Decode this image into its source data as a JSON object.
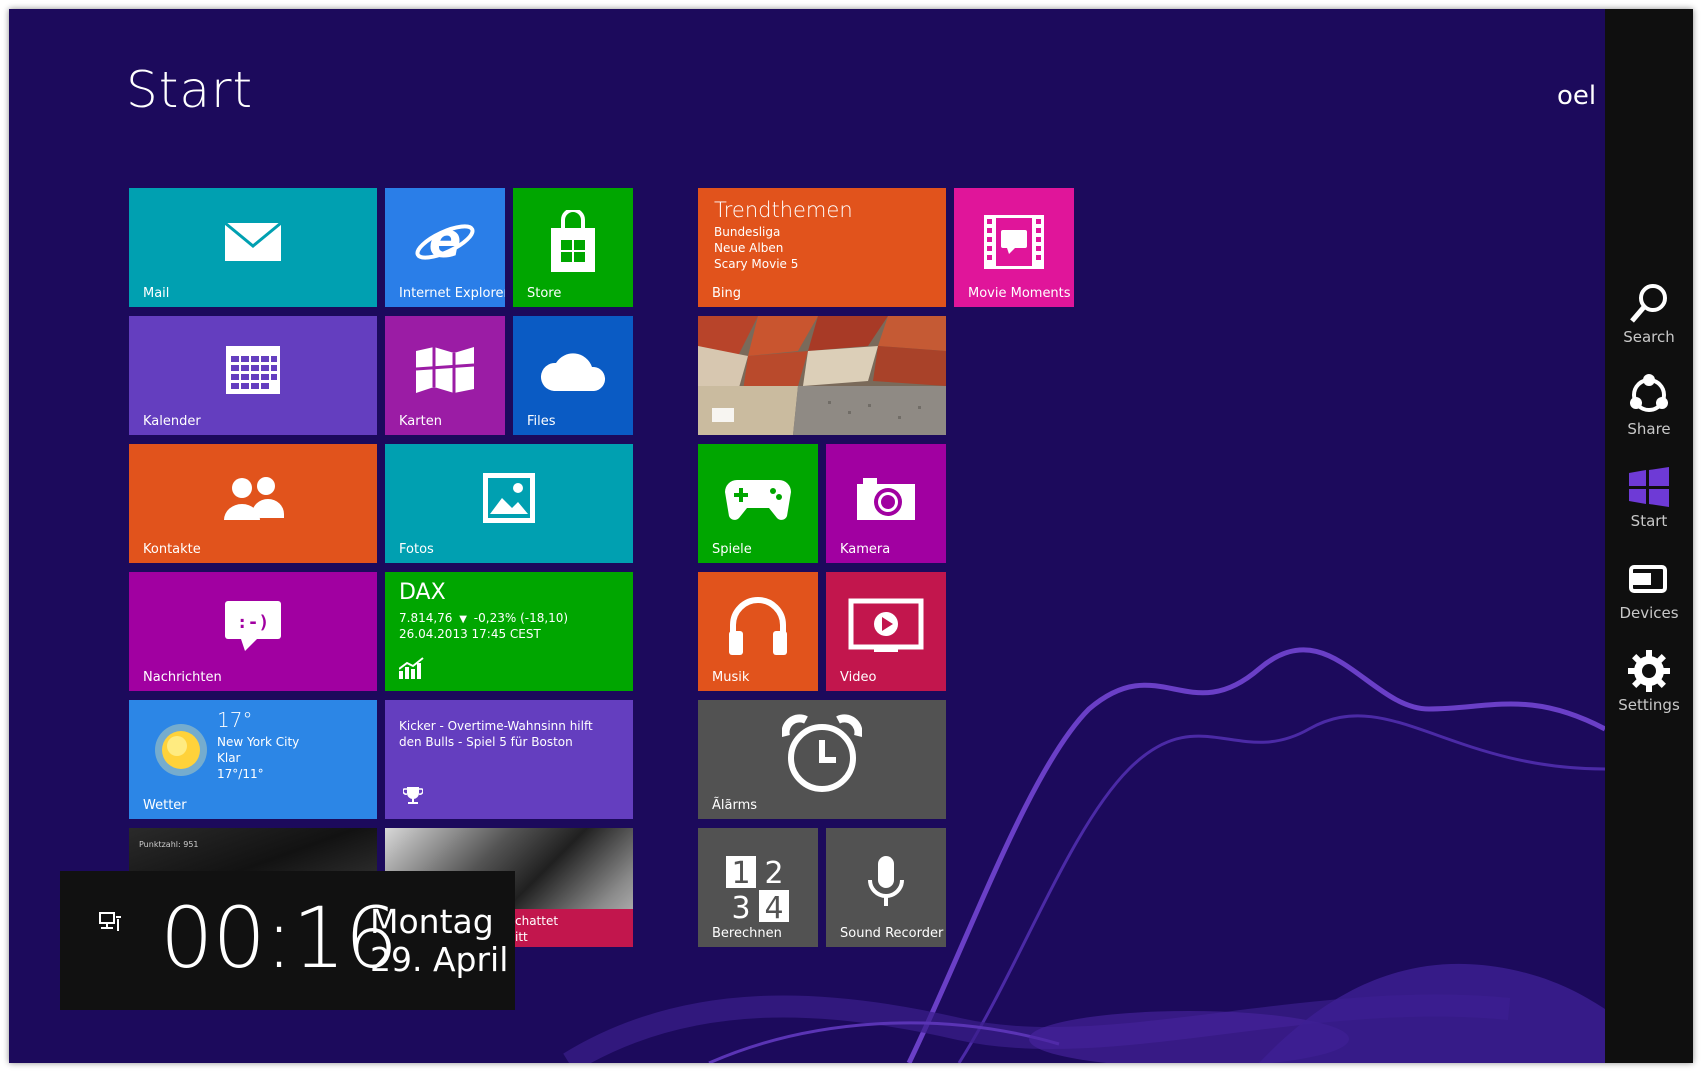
{
  "screen": {
    "title": "Start",
    "user": "oel"
  },
  "tiles": {
    "mail": {
      "label": "Mail",
      "color": "#00a0b1"
    },
    "ie": {
      "label": "Internet Explorer",
      "color": "#2a7ee8"
    },
    "store": {
      "label": "Store",
      "color": "#00a600"
    },
    "kalender": {
      "label": "Kalender",
      "color": "#643ebf"
    },
    "karten": {
      "label": "Karten",
      "color": "#9b1ca5"
    },
    "files": {
      "label": "Files",
      "color": "#0a5bc4"
    },
    "kontakte": {
      "label": "Kontakte",
      "color": "#e1531c"
    },
    "fotos": {
      "label": "Fotos",
      "color": "#00a0b1"
    },
    "nachrichten": {
      "label": "Nachrichten",
      "color": "#a100a1",
      "icon_text": ":-)"
    },
    "dax": {
      "title": "DAX",
      "line1_value": "7.814,76",
      "line1_change": "-0,23% (-18,10)",
      "line2": "26.04.2013 17:45 CEST",
      "color": "#00a600"
    },
    "wetter": {
      "label": "Wetter",
      "temp": "17°",
      "city": "New York City",
      "condition": "Klar",
      "range": "17°/11°",
      "color": "#2c86e6"
    },
    "sport": {
      "headline": "Kicker - Overtime-Wahnsinn hilft den Bulls - Spiel 5 für Boston",
      "color": "#643ebf"
    },
    "trend": {
      "title": "Trendthemen",
      "items": [
        "Bundesliga",
        "Neue Alben",
        "Scary Movie 5"
      ],
      "label": "Bing",
      "color": "#e1531c"
    },
    "movie": {
      "label": "Movie Moments",
      "color": "#e0159a"
    },
    "spiele": {
      "label": "Spiele",
      "color": "#00a600"
    },
    "kamera": {
      "label": "Kamera",
      "color": "#a100a1"
    },
    "musik": {
      "label": "Musik",
      "color": "#e1531c"
    },
    "video": {
      "label": "Video",
      "color": "#c2164d"
    },
    "alarm": {
      "label": "Ãlãrms",
      "color": "#525252"
    },
    "berechnen": {
      "label": "Berechnen",
      "color": "#525252"
    },
    "sound": {
      "label": "Sound Recorder",
      "color": "#525252"
    },
    "news_photo": {
      "overlay_text": "Punktzahl: 951"
    },
    "news2": {
      "caption_line1": "chattet",
      "caption_line2": "itt",
      "color": "#c2164d"
    }
  },
  "charms": [
    {
      "label": "Search",
      "icon": "search-icon"
    },
    {
      "label": "Share",
      "icon": "share-icon"
    },
    {
      "label": "Start",
      "icon": "windows-logo-icon"
    },
    {
      "label": "Devices",
      "icon": "devices-icon"
    },
    {
      "label": "Settings",
      "icon": "settings-gear-icon"
    }
  ],
  "clock": {
    "time": "00:16",
    "day": "Montag",
    "date": "29. April"
  }
}
